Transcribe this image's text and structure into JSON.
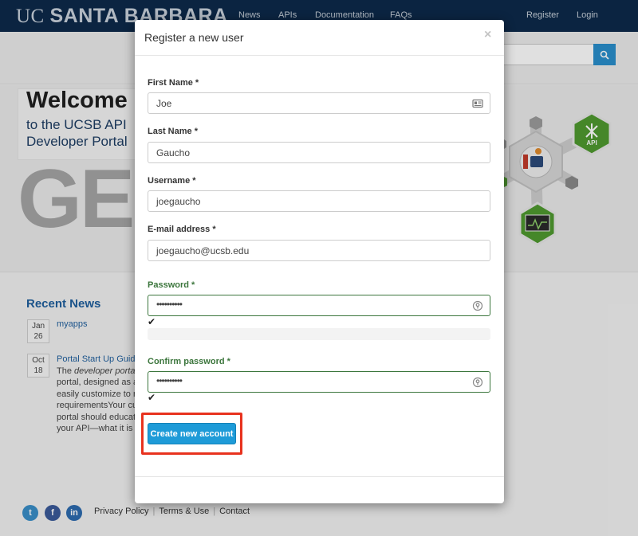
{
  "header": {
    "logo_light": "UC",
    "logo_bold": "SANTA BARBARA",
    "nav": [
      "News",
      "APIs",
      "Documentation",
      "FAQs"
    ],
    "register": "Register",
    "login": "Login"
  },
  "hero": {
    "title": "Welcome",
    "subtitle_line1": "to the UCSB API",
    "subtitle_line2": "Developer Portal",
    "big_text": "GE",
    "badge_text": "API"
  },
  "recent_news": {
    "title": "Recent News",
    "items": [
      {
        "month": "Jan",
        "day": "26",
        "title": "myapps"
      },
      {
        "month": "Oct",
        "day": "18",
        "title": "Portal Start Up Guide"
      }
    ],
    "excerpt_lines": [
      {
        "pre": "The ",
        "em": "developer portal",
        "post": ""
      },
      {
        "pre": "portal, designed as a",
        "em": "",
        "post": ""
      },
      {
        "pre": "easily customize to m",
        "em": "",
        "post": ""
      },
      {
        "pre": "requirementsYour cus",
        "em": "",
        "post": ""
      },
      {
        "pre": "portal should educate",
        "em": "",
        "post": ""
      },
      {
        "pre": "your API—what it is a",
        "em": "",
        "post": ""
      }
    ]
  },
  "footer": {
    "social": [
      "twitter-icon",
      "facebook-icon",
      "linkedin-icon"
    ],
    "links": [
      "Privacy Policy",
      "Terms & Use",
      "Contact"
    ]
  },
  "modal": {
    "title": "Register a new user",
    "close": "×",
    "fields": {
      "first_name": {
        "label": "First Name *",
        "value": "Joe"
      },
      "last_name": {
        "label": "Last Name *",
        "value": "Gaucho"
      },
      "username": {
        "label": "Username *",
        "value": "joegaucho"
      },
      "email": {
        "label": "E-mail address *",
        "value": "joegaucho@ucsb.edu"
      },
      "password": {
        "label": "Password *",
        "value": "••••••••••"
      },
      "confirm_password": {
        "label": "Confirm password *",
        "value": "••••••••••"
      }
    },
    "check_mark": "✔",
    "submit": "Create new account"
  },
  "colors": {
    "header_bg": "#0d2a4a",
    "link_blue": "#1f5f9e",
    "button_blue": "#1e9bd8",
    "valid_green": "#3c763d",
    "highlight_red": "#e8321e"
  }
}
